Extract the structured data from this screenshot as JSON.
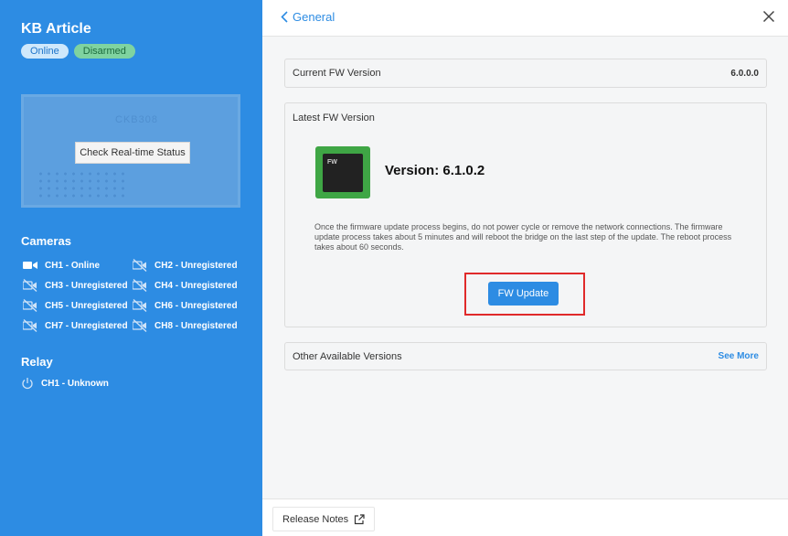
{
  "sidebar": {
    "title": "KB Article",
    "badges": {
      "online": "Online",
      "disarmed": "Disarmed"
    },
    "device": {
      "model": "CKB308",
      "check_button": "Check Real-time Status"
    },
    "cameras_title": "Cameras",
    "cameras": [
      {
        "label": "CH1 - Online",
        "icon": "camera-icon"
      },
      {
        "label": "CH2 - Unregistered",
        "icon": "camera-off-icon"
      },
      {
        "label": "CH3 - Unregistered",
        "icon": "camera-off-icon"
      },
      {
        "label": "CH4 - Unregistered",
        "icon": "camera-off-icon"
      },
      {
        "label": "CH5 - Unregistered",
        "icon": "camera-off-icon"
      },
      {
        "label": "CH6 - Unregistered",
        "icon": "camera-off-icon"
      },
      {
        "label": "CH7 - Unregistered",
        "icon": "camera-off-icon"
      },
      {
        "label": "CH8 - Unregistered",
        "icon": "camera-off-icon"
      }
    ],
    "relay_title": "Relay",
    "relay": {
      "label": "CH1 - Unknown",
      "icon": "power-icon"
    }
  },
  "header": {
    "back_label": "General",
    "close_icon": "close-icon"
  },
  "current_fw": {
    "label": "Current FW Version",
    "value": "6.0.0.0"
  },
  "latest_fw": {
    "label": "Latest FW Version",
    "version": "Version: 6.1.0.2",
    "chip_text": "FW",
    "note": "Once the firmware update process begins, do not power cycle or remove the network connections. The firmware update process takes about 5 minutes and will reboot the bridge on the last step of the update. The reboot process takes about 60 seconds.",
    "update_button": "FW Update"
  },
  "other_versions": {
    "label": "Other Available Versions",
    "link": "See More"
  },
  "footer": {
    "release_notes": "Release Notes",
    "icon": "external-link-icon"
  },
  "colors": {
    "sidebar": "#2d8ce3",
    "accent": "#2d8ce3",
    "highlight": "#e02a2a",
    "online_badge": "#cfe8fb",
    "disarmed_badge": "#7fd3a0"
  }
}
